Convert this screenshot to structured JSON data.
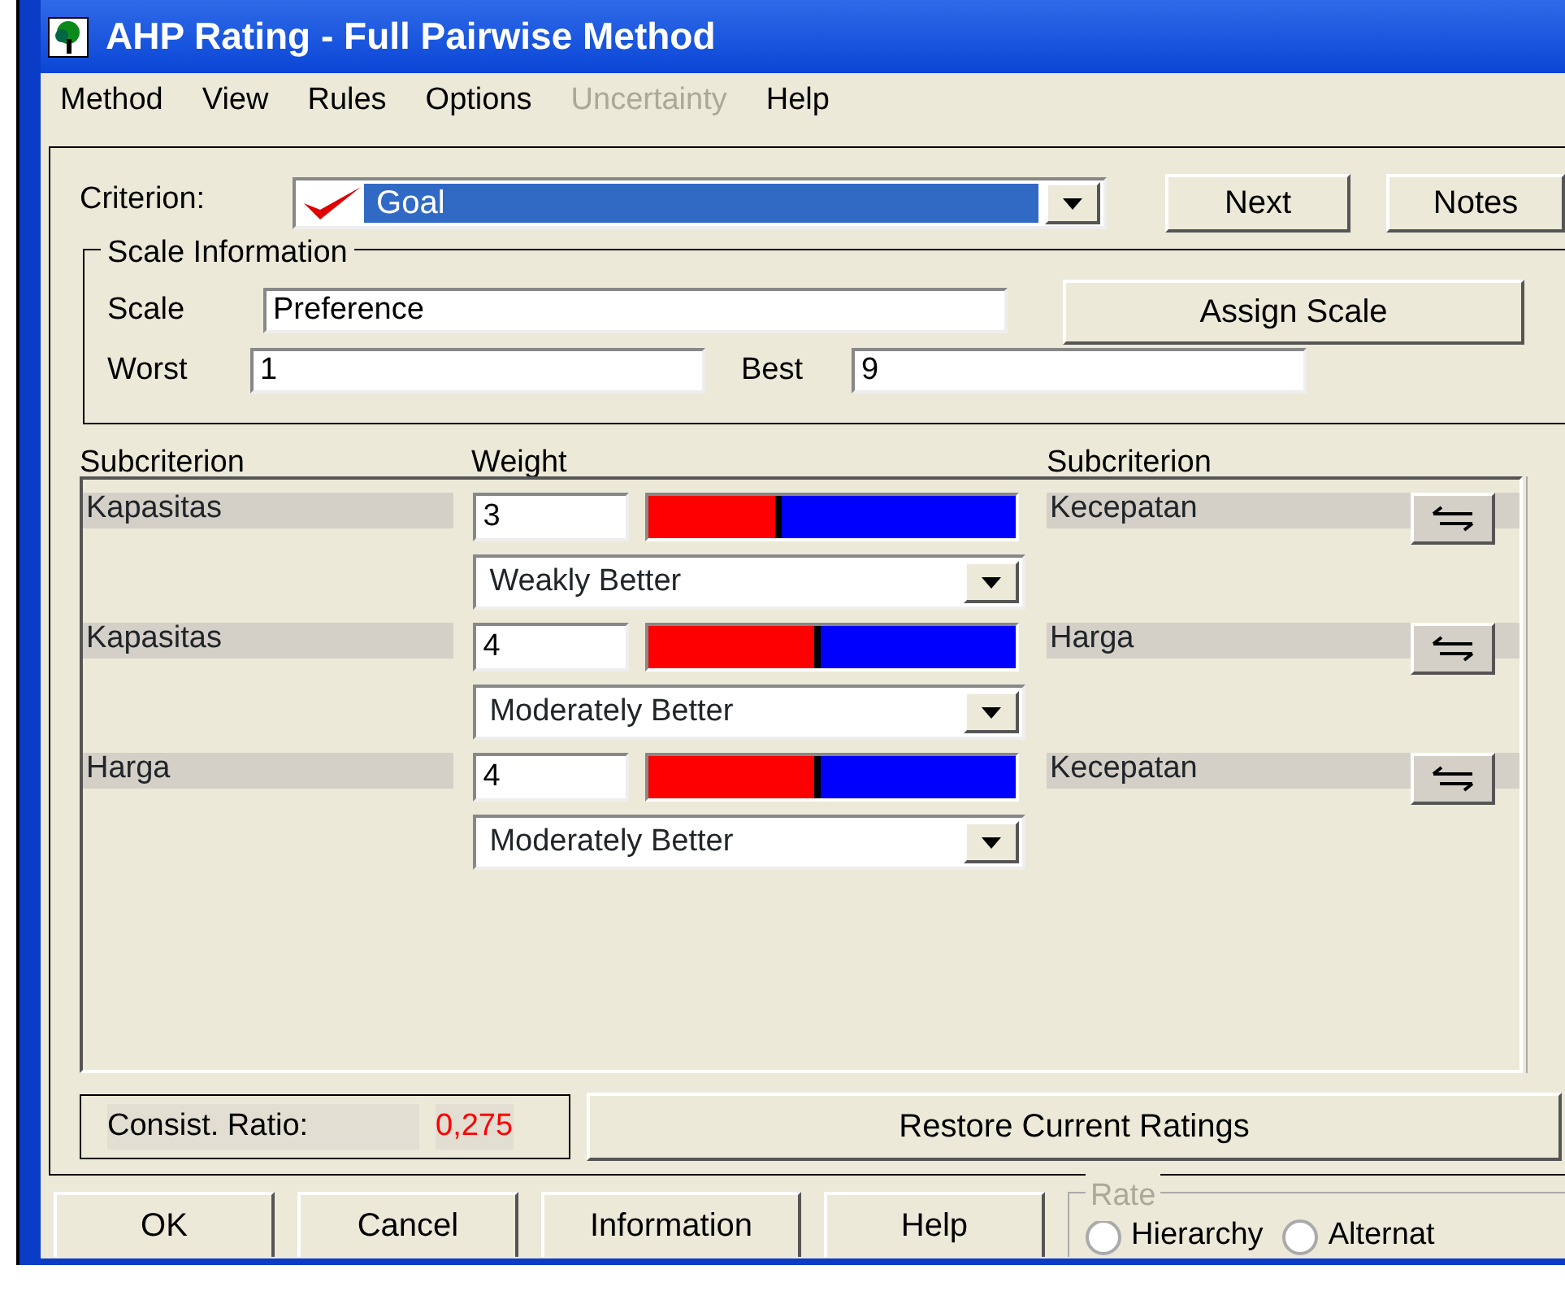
{
  "window": {
    "title": "AHP Rating - Full Pairwise Method"
  },
  "menu": [
    {
      "label": "Method",
      "disabled": false
    },
    {
      "label": "View",
      "disabled": false
    },
    {
      "label": "Rules",
      "disabled": false
    },
    {
      "label": "Options",
      "disabled": false
    },
    {
      "label": "Uncertainty",
      "disabled": true
    },
    {
      "label": "Help",
      "disabled": false
    }
  ],
  "criterion": {
    "label": "Criterion:",
    "value": "Goal"
  },
  "top_buttons": [
    {
      "label": "Next"
    },
    {
      "label": "Notes"
    }
  ],
  "scale_info": {
    "title": "Scale Information",
    "scale_label": "Scale",
    "scale_value": "Preference",
    "assign_button": {
      "label": "Assign Scale"
    },
    "worst_label": "Worst",
    "worst_value": "1",
    "best_label": "Best",
    "best_value": "9"
  },
  "columns": [
    "Subcriterion",
    "Weight",
    "Subcriterion"
  ],
  "comparisons": [
    {
      "left": "Kapasitas",
      "weight": "3",
      "level": 0.36,
      "verbal": "Weakly Better",
      "right": "Kecepatan"
    },
    {
      "left": "Kapasitas",
      "weight": "4",
      "level": 0.47,
      "verbal": "Moderately Better",
      "right": "Harga"
    },
    {
      "left": "Harga",
      "weight": "4",
      "level": 0.47,
      "verbal": "Moderately Better",
      "right": "Kecepatan"
    }
  ],
  "consistency": {
    "label": "Consist. Ratio:",
    "value": "0,275"
  },
  "restore_button": {
    "label": "Restore Current Ratings"
  },
  "bottom_buttons": [
    {
      "label": "OK"
    },
    {
      "label": "Cancel"
    },
    {
      "label": "Information"
    },
    {
      "label": "Help"
    }
  ],
  "rate": {
    "title": "Rate",
    "options": [
      {
        "label": "Hierarchy",
        "selected": false
      },
      {
        "label": "Alternat",
        "selected": false
      }
    ]
  }
}
